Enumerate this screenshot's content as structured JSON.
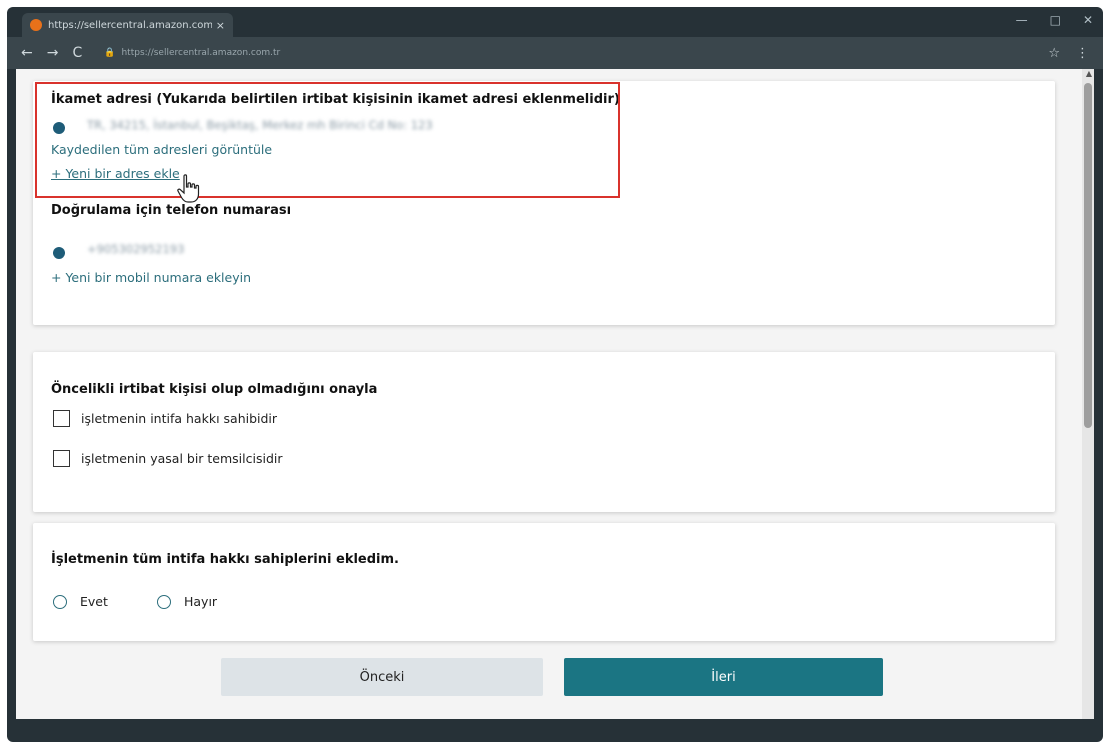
{
  "browser": {
    "tab_title": "https://sellercentral.amazon.com.tr",
    "tab_close": "×",
    "address": "https://sellercentral.amazon.com.tr",
    "controls": {
      "minimize": "—",
      "maximize": "□",
      "close": "✕"
    }
  },
  "address_section": {
    "heading": "İkamet adresi (Yukarıda belirtilen irtibat kişisinin ikamet adresi eklenmelidir)",
    "saved_address": "TR, 34215, İstanbul, Beşiktaş, Merkez mh Birinci Cd No: 123",
    "view_all_link": "Kaydedilen tüm adresleri görüntüle",
    "add_address_link": "+ Yeni bir adres ekle"
  },
  "phone_section": {
    "heading": "Doğrulama için telefon numarası",
    "saved_phone": "+905302952193",
    "add_mobile_link": "+ Yeni bir mobil numara ekleyin"
  },
  "contact_section": {
    "heading": "Öncelikli irtibat kişisi olup olmadığını onayla",
    "option_owner": "işletmenin intifa hakkı sahibidir",
    "option_representative": "işletmenin yasal bir temsilcisidir"
  },
  "owners_section": {
    "heading": "İşletmenin tüm intifa hakkı sahiplerini ekledim.",
    "yes": "Evet",
    "no": "Hayır"
  },
  "actions": {
    "previous": "Önceki",
    "next": "İleri"
  },
  "colors": {
    "accent": "#1b7583",
    "link": "#2c6e7c",
    "highlight_box": "#d9322c",
    "browser_chrome": "#263137"
  },
  "icons": [
    "site-favicon",
    "back-icon",
    "forward-icon",
    "reload-icon",
    "lock-icon",
    "star-icon",
    "menu-icon",
    "hand-cursor-icon"
  ]
}
